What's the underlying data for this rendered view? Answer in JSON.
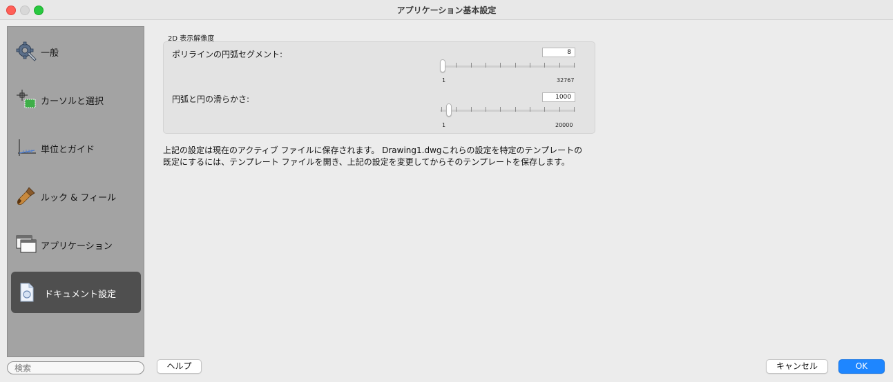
{
  "window": {
    "title": "アプリケーション基本設定"
  },
  "sidebar": {
    "items": [
      {
        "label": "一般",
        "icon": "gear-wrench-icon"
      },
      {
        "label": "カーソルと選択",
        "icon": "crosshair-selection-icon"
      },
      {
        "label": "単位とガイド",
        "icon": "units-guide-icon"
      },
      {
        "label": "ルック & フィール",
        "icon": "paintbrush-icon"
      },
      {
        "label": "アプリケーション",
        "icon": "application-windows-icon"
      },
      {
        "label": "ドキュメント設定",
        "icon": "document-icon",
        "selected": true
      }
    ],
    "search_placeholder": "検索"
  },
  "section": {
    "title": "2D 表示解像度",
    "polyline": {
      "label": "ポリラインの円弧セグメント:",
      "value": "8",
      "min_label": "1",
      "max_label": "32767",
      "slider_fraction": 0.0
    },
    "arc_smoothness": {
      "label": "円弧と円の滑らかさ:",
      "value": "1000",
      "min_label": "1",
      "max_label": "20000",
      "slider_fraction": 0.05
    }
  },
  "description": {
    "line1": "上記の設定は現在のアクティブ ファイルに保存されます。 Drawing1.dwgこれらの設定を特定のテンプレートの",
    "line2": "既定にするには、テンプレート ファイルを開き、上記の設定を変更してからそのテンプレートを保存します。"
  },
  "buttons": {
    "help": "ヘルプ",
    "cancel": "キャンセル",
    "ok": "OK"
  },
  "colors": {
    "accent": "#1e86ff",
    "sidebar_bg": "#a3a3a3",
    "selected_bg": "#4f4f4f"
  }
}
